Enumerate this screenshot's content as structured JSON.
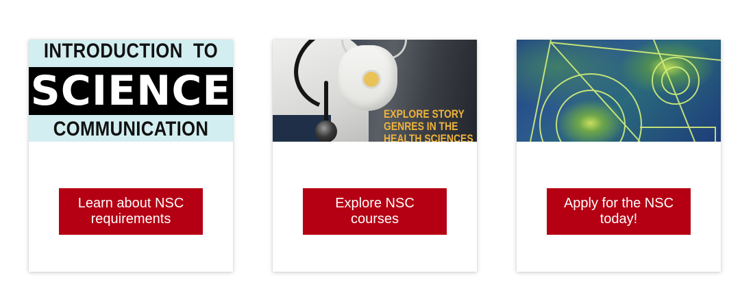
{
  "cards": [
    {
      "image": {
        "line_top": "INTRODUCTION  TO",
        "band": "SCIENCE",
        "line_bottom": "COMMUNICATION"
      },
      "button_label": "Learn about NSC\nrequirements"
    },
    {
      "image": {
        "overlay_line_1": "EXPLORE STORY",
        "overlay_line_2": "GENRES IN THE",
        "overlay_line_3": "HEALTH SCIENCES"
      },
      "button_label": "Explore NSC\ncourses"
    },
    {
      "image": {},
      "button_label": "Apply for the NSC\ntoday!"
    }
  ],
  "colors": {
    "button_bg": "#b50013",
    "button_text": "#ffffff",
    "card1_bg": "#d3eef0",
    "card2_overlay_text": "#f0b33c",
    "card3_lines": "#d6f07a"
  }
}
